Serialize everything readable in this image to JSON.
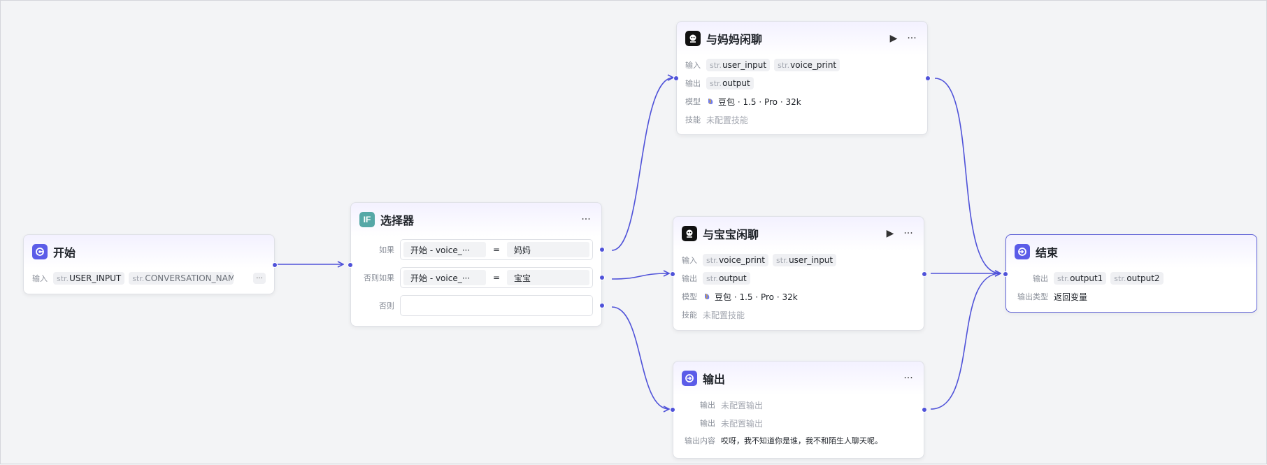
{
  "nodes": {
    "start": {
      "title": "开始",
      "input_label": "输入",
      "inputs": [
        {
          "type": "str.",
          "name": "USER_INPUT"
        },
        {
          "type": "str.",
          "name": "CONVERSATION_NAME"
        }
      ],
      "more": "···"
    },
    "selector": {
      "title": "选择器",
      "more": "···",
      "conditions": [
        {
          "label": "如果",
          "left": "开始 - voice_···",
          "op": "=",
          "right": "妈妈"
        },
        {
          "label": "否则如果",
          "left": "开始 - voice_···",
          "op": "=",
          "right": "宝宝"
        },
        {
          "label": "否则",
          "left": "",
          "op": "",
          "right": ""
        }
      ]
    },
    "chat_mom": {
      "title": "与妈妈闲聊",
      "run": "▶",
      "more": "···",
      "input_label": "输入",
      "inputs": [
        {
          "type": "str.",
          "name": "user_input"
        },
        {
          "type": "str.",
          "name": "voice_print"
        }
      ],
      "output_label": "输出",
      "outputs": [
        {
          "type": "str.",
          "name": "output"
        }
      ],
      "model_label": "模型",
      "model": "豆包 · 1.5 · Pro · 32k",
      "skill_label": "技能",
      "skill": "未配置技能"
    },
    "chat_baby": {
      "title": "与宝宝闲聊",
      "run": "▶",
      "more": "···",
      "input_label": "输入",
      "inputs": [
        {
          "type": "str.",
          "name": "voice_print"
        },
        {
          "type": "str.",
          "name": "user_input"
        }
      ],
      "output_label": "输出",
      "outputs": [
        {
          "type": "str.",
          "name": "output"
        }
      ],
      "model_label": "模型",
      "model": "豆包 · 1.5 · Pro · 32k",
      "skill_label": "技能",
      "skill": "未配置技能"
    },
    "output": {
      "title": "输出",
      "more": "···",
      "rows": [
        {
          "label": "输出",
          "value": "未配置输出"
        },
        {
          "label": "输出",
          "value": "未配置输出"
        }
      ],
      "content_label": "输出内容",
      "content": "哎呀，我不知道你是谁，我不和陌生人聊天呢。"
    },
    "end": {
      "title": "结束",
      "output_label": "输出",
      "outputs": [
        {
          "type": "str.",
          "name": "output1"
        },
        {
          "type": "str.",
          "name": "output2"
        }
      ],
      "output_type_label": "输出类型",
      "output_type": "返回变量"
    }
  },
  "colors": {
    "accent": "#5b5ce8",
    "edge": "#4f52d9",
    "canvas_bg": "#f3f4f6",
    "selector_icon": "#55a8a6"
  },
  "icons": {
    "start": "start-icon",
    "selector": "if-icon",
    "chat": "bot-icon",
    "output": "output-icon",
    "end": "end-icon"
  }
}
